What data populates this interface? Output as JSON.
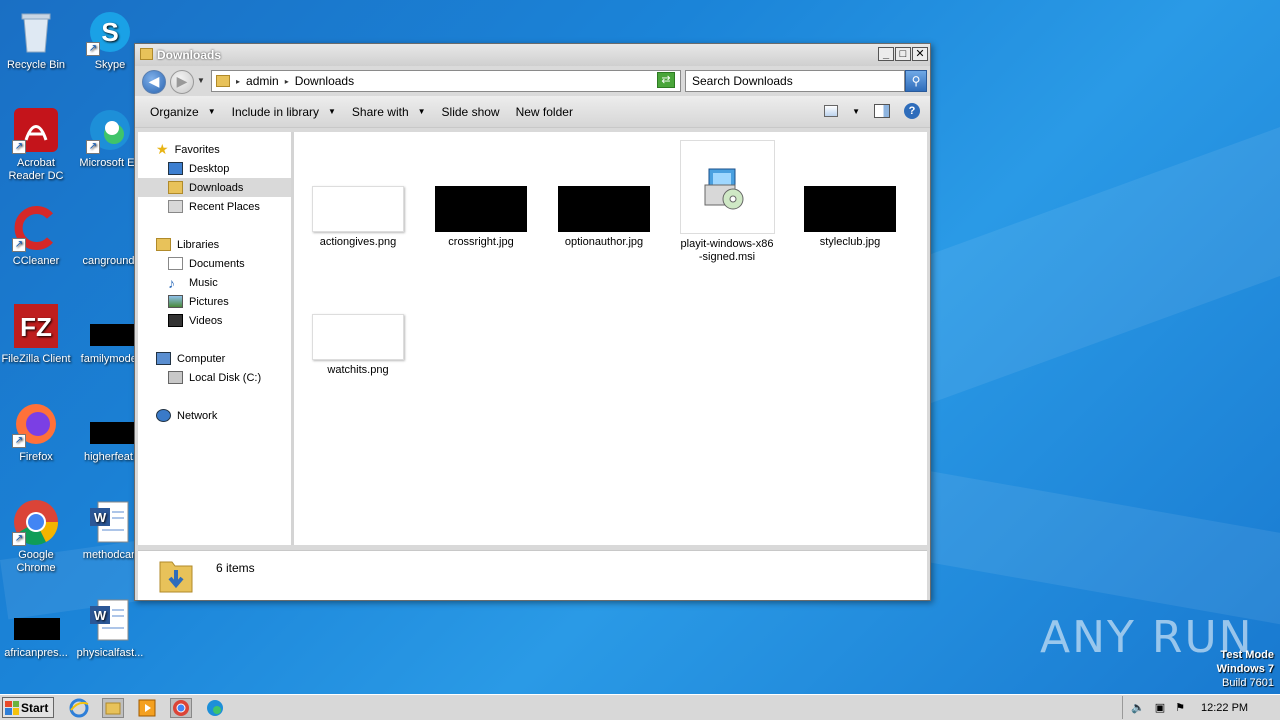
{
  "desktop": {
    "icons": [
      {
        "label": "Recycle Bin",
        "icon": "recycle-bin-icon"
      },
      {
        "label": "Skype",
        "icon": "skype-icon"
      },
      {
        "label": "Acrobat Reader DC",
        "icon": "acrobat-icon"
      },
      {
        "label": "Microsoft Ed",
        "icon": "edge-icon"
      },
      {
        "label": "CCleaner",
        "icon": "ccleaner-icon"
      },
      {
        "label": "canground.",
        "icon": "blank-file-icon"
      },
      {
        "label": "FileZilla Client",
        "icon": "filezilla-icon"
      },
      {
        "label": "familymodel",
        "icon": "black-thumbnail-icon"
      },
      {
        "label": "Firefox",
        "icon": "firefox-icon"
      },
      {
        "label": "higherfeat.",
        "icon": "black-thumbnail-icon"
      },
      {
        "label": "Google Chrome",
        "icon": "chrome-icon"
      },
      {
        "label": "methodcan",
        "icon": "word-doc-icon"
      },
      {
        "label": "africanpres...",
        "icon": "black-thumbnail-icon"
      },
      {
        "label": "physicalfast...",
        "icon": "word-doc-icon"
      }
    ]
  },
  "window": {
    "title": "Downloads",
    "buttons": {
      "minimize": "_",
      "maximize": "□",
      "close": "✕"
    },
    "address": {
      "parts": [
        "admin",
        "Downloads"
      ]
    },
    "search_placeholder": "Search Downloads",
    "toolbar": {
      "organize": "Organize",
      "include": "Include in library",
      "share": "Share with",
      "slideshow": "Slide show",
      "newfolder": "New folder"
    },
    "nav": {
      "favorites": "Favorites",
      "desktop": "Desktop",
      "downloads": "Downloads",
      "recent": "Recent Places",
      "libraries": "Libraries",
      "documents": "Documents",
      "music": "Music",
      "pictures": "Pictures",
      "videos": "Videos",
      "computer": "Computer",
      "localdisk": "Local Disk (C:)",
      "network": "Network"
    },
    "files": [
      {
        "name": "actiongives.png",
        "thumb": "white"
      },
      {
        "name": "crossright.jpg",
        "thumb": "black"
      },
      {
        "name": "optionauthor.jpg",
        "thumb": "black"
      },
      {
        "name": "playit-windows-x86-signed.msi",
        "name_lines": [
          "playit-windows-x86",
          "-signed.msi"
        ],
        "thumb": "installer"
      },
      {
        "name": "styleclub.jpg",
        "thumb": "black"
      },
      {
        "name": "watchits.png",
        "thumb": "white"
      }
    ],
    "status": "6 items"
  },
  "taskbar": {
    "start": "Start",
    "clock": "12:22 PM"
  },
  "watermark": "ANY RUN",
  "testmode": {
    "line1": "Test Mode",
    "line2": "Windows 7",
    "line3": "Build 7601"
  },
  "colors": {
    "desktop": "#1b84d8",
    "selection": "#d9d9d9"
  }
}
